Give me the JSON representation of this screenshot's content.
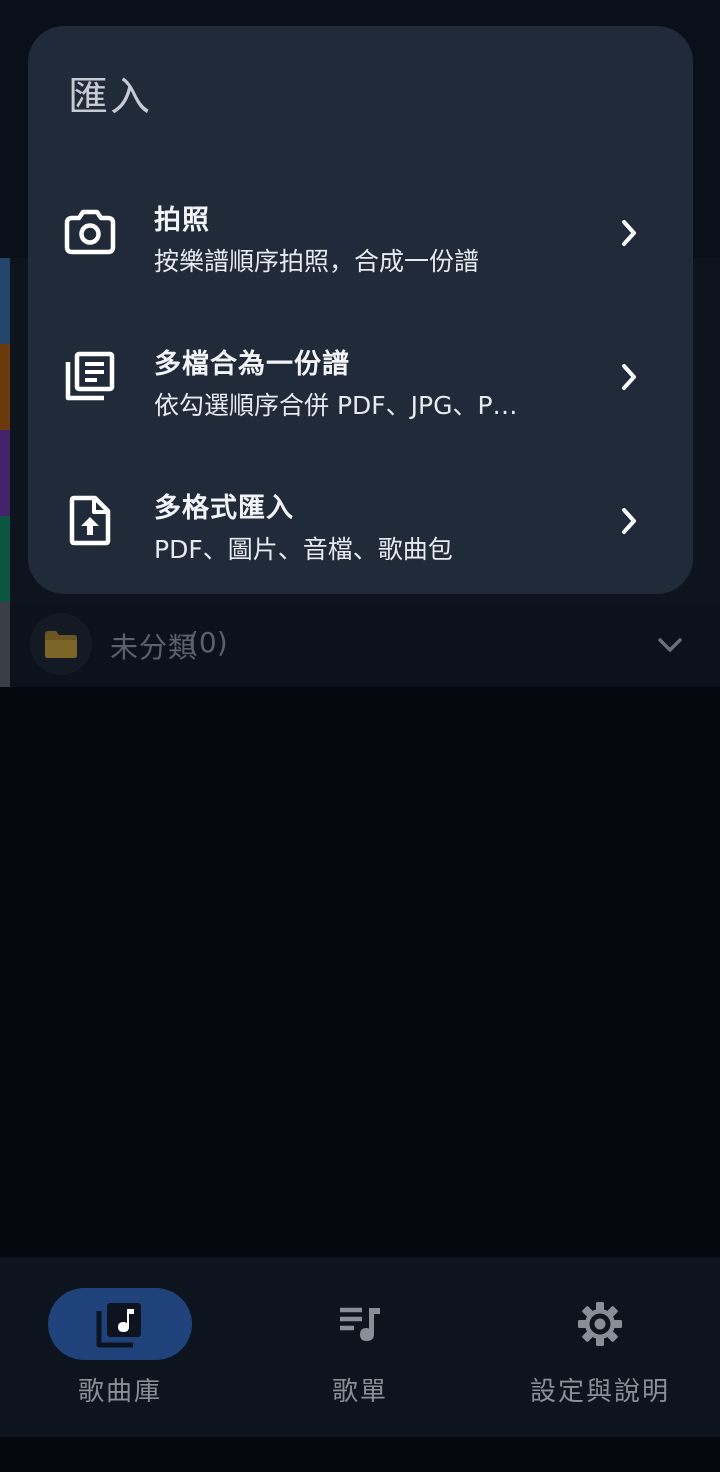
{
  "import_sheet": {
    "title": "匯入",
    "options": [
      {
        "title": "拍照",
        "subtitle": "按樂譜順序拍照，合成一份譜",
        "icon": "camera-icon"
      },
      {
        "title": "多檔合為一份譜",
        "subtitle": "依勾選順序合併 PDF、JPG、P…",
        "icon": "library-books-icon"
      },
      {
        "title": "多格式匯入",
        "subtitle": "PDF、圖片、音檔、歌曲包",
        "icon": "file-upload-icon"
      }
    ]
  },
  "background_list": {
    "category_colors": [
      "#2f5a86",
      "#8a4b0e",
      "#5a2e86",
      "#0f6a4e"
    ],
    "uncategorized": {
      "label": "未分類",
      "count": "(0)",
      "icon": "folder-icon"
    }
  },
  "bottom_nav": {
    "items": [
      {
        "label": "歌曲庫",
        "icon": "music-library-icon",
        "active": true
      },
      {
        "label": "歌單",
        "icon": "playlist-icon",
        "active": false
      },
      {
        "label": "設定與說明",
        "icon": "gear-icon",
        "active": false
      }
    ]
  }
}
